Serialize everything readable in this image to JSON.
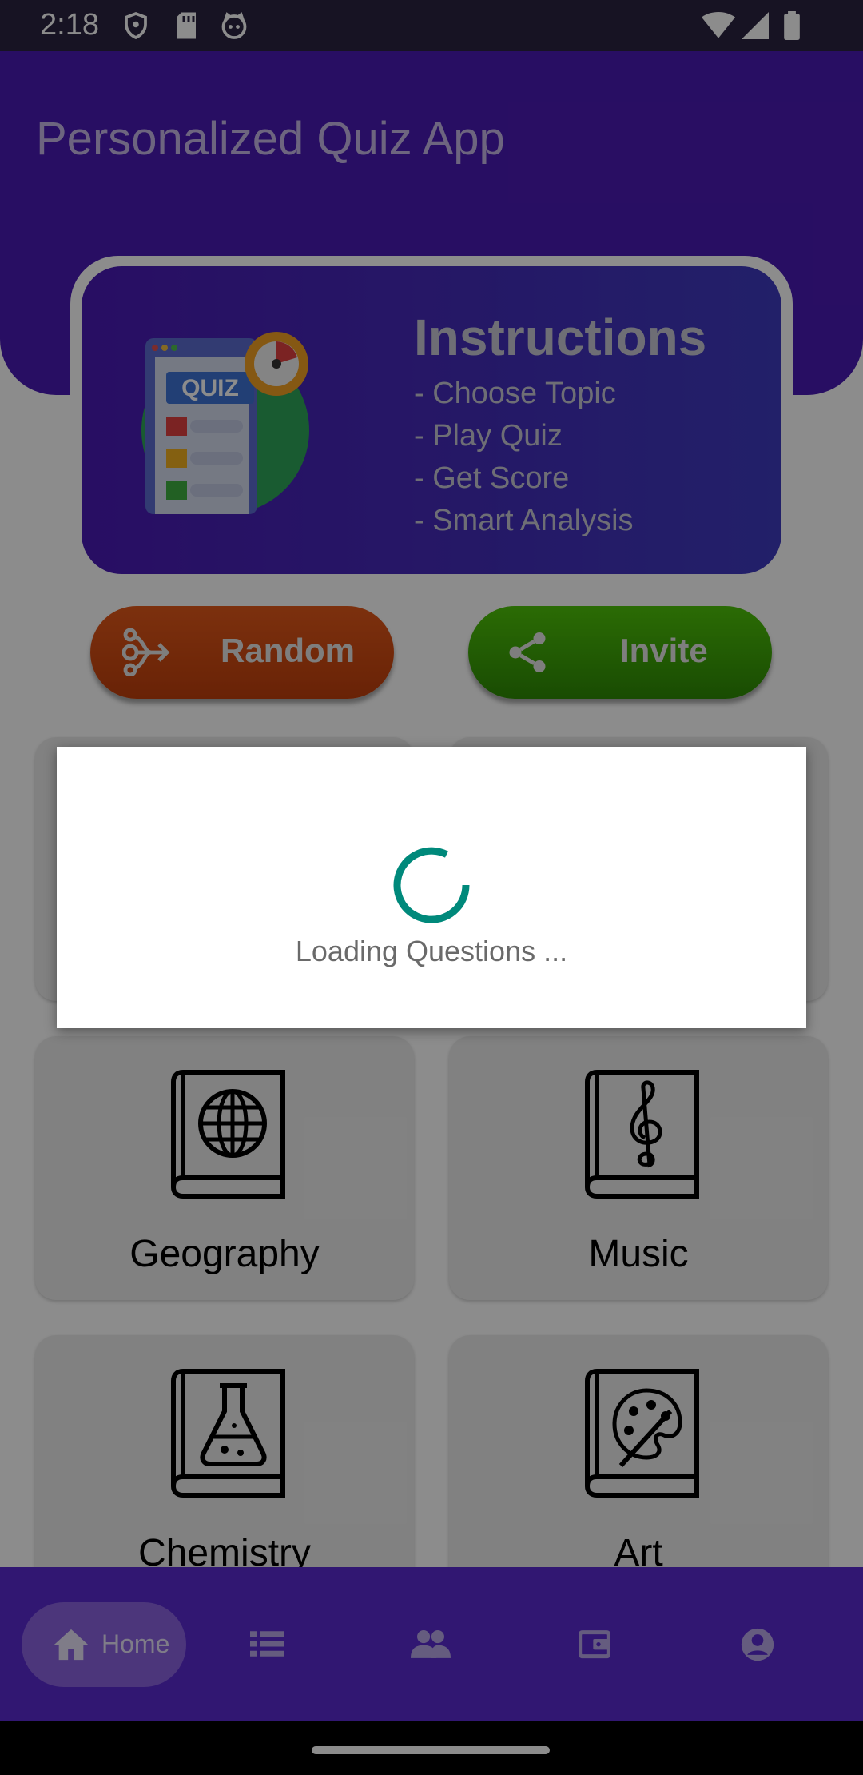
{
  "status_bar": {
    "time": "2:18",
    "icons": [
      "shield-icon",
      "sd-card-icon",
      "cat-face-icon",
      "wifi-icon",
      "signal-icon",
      "battery-icon"
    ]
  },
  "header": {
    "title": "Personalized Quiz App"
  },
  "instructions": {
    "illustration_text": "QUIZ",
    "title": "Instructions",
    "lines": [
      "- Choose Topic",
      "- Play Quiz",
      "- Get Score",
      "- Smart Analysis"
    ]
  },
  "actions": {
    "random_label": "Random",
    "invite_label": "Invite"
  },
  "topics": [
    {
      "label": "Geography",
      "icon": "globe-book-icon"
    },
    {
      "label": "Music",
      "icon": "treble-clef-book-icon"
    },
    {
      "label": "Chemistry",
      "icon": "flask-book-icon"
    },
    {
      "label": "Art",
      "icon": "palette-book-icon"
    }
  ],
  "dialog": {
    "message": "Loading Questions ..."
  },
  "bottom_nav": {
    "items": [
      {
        "label": "Home",
        "icon": "home-icon",
        "selected": true
      },
      {
        "label": "",
        "icon": "list-icon"
      },
      {
        "label": "",
        "icon": "people-icon"
      },
      {
        "label": "",
        "icon": "wallet-icon"
      },
      {
        "label": "",
        "icon": "account-icon"
      }
    ]
  },
  "colors": {
    "header": "#4a1ab5",
    "random_button": "#d94d14",
    "invite_button": "#3fa508",
    "spinner": "#00897b",
    "bottom_nav": "#5a2bd0"
  }
}
